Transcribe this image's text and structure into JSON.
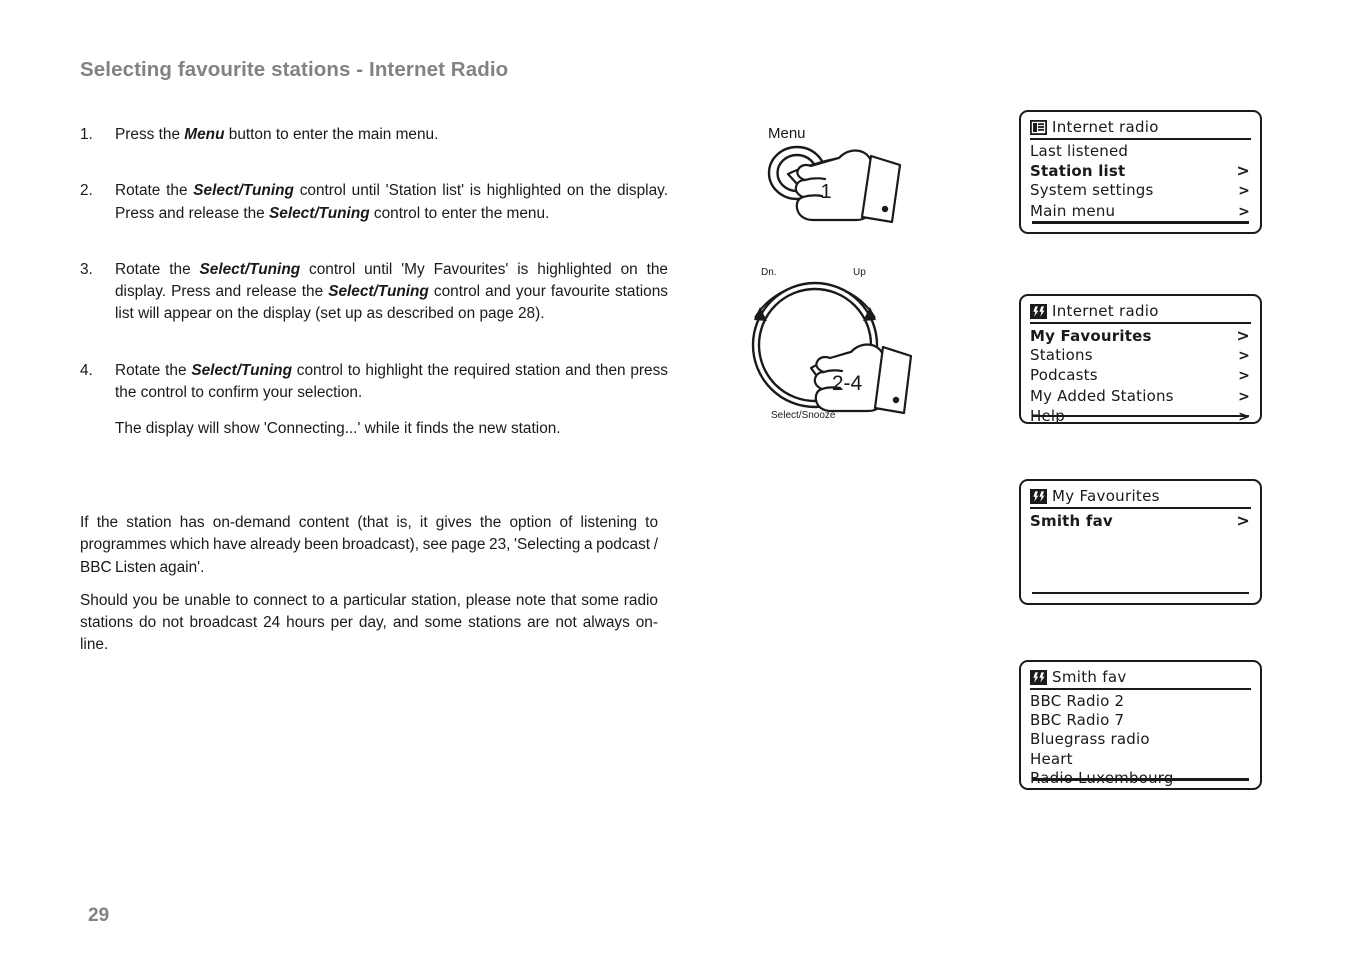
{
  "page": {
    "title": "Selecting favourite stations - Internet Radio",
    "number": "29"
  },
  "instructions": [
    {
      "num": "1.",
      "parts": [
        {
          "t": "Press the ",
          "b": false
        },
        {
          "t": "Menu",
          "b": true
        },
        {
          "t": " button to enter the main menu.",
          "b": false
        }
      ]
    },
    {
      "num": "2.",
      "parts": [
        {
          "t": "Rotate the ",
          "b": false
        },
        {
          "t": "Select/Tuning",
          "b": true
        },
        {
          "t": " control until 'Station list' is highlighted on the display. Press and release the ",
          "b": false
        },
        {
          "t": "Select/Tuning",
          "b": true
        },
        {
          "t": " control to enter the menu.",
          "b": false
        }
      ]
    },
    {
      "num": "3.",
      "parts": [
        {
          "t": "Rotate the ",
          "b": false
        },
        {
          "t": "Select/Tuning",
          "b": true
        },
        {
          "t": " control until 'My Favourites' is highlighted on the display. Press and release the ",
          "b": false
        },
        {
          "t": "Select/Tuning",
          "b": true
        },
        {
          "t": " control and your favourite stations list will appear on the display (set up as described on page 28).",
          "b": false
        }
      ]
    },
    {
      "num": "4.",
      "parts": [
        {
          "t": "Rotate the ",
          "b": false
        },
        {
          "t": "Select/Tuning",
          "b": true
        },
        {
          "t": " control to highlight the required station and then press the control to confirm your selection.",
          "b": false
        }
      ],
      "sub": "The display will show 'Connecting...' while it finds the new station."
    }
  ],
  "notes": [
    "If the station has on-demand content (that is, it gives the option of listening to programmes which have already been broadcast), see page 23, 'Selecting a podcast / BBC Listen again'.",
    "Should you be unable to connect to a particular station, please note that some radio stations do not broadcast 24 hours per day, and some stations are not always on-line."
  ],
  "illustrations": {
    "menu_button": {
      "label": "Menu",
      "step_number": "1"
    },
    "rotary": {
      "label_down": "Dn.",
      "label_up": "Up",
      "label_select": "Select/Snooze",
      "step_number": "2-4"
    }
  },
  "displays": [
    {
      "icon": "list-icon",
      "title": "Internet radio",
      "rows": [
        {
          "label": "Last listened",
          "arrow": "",
          "selected": false
        },
        {
          "label": "Station list",
          "arrow": ">",
          "selected": true
        },
        {
          "label": "System settings",
          "arrow": ">",
          "selected": false
        },
        {
          "label": "Main menu",
          "arrow": ">",
          "selected": false
        }
      ]
    },
    {
      "icon": "stations-icon",
      "title": "Internet radio",
      "rows": [
        {
          "label": "My Favourites",
          "arrow": ">",
          "selected": true
        },
        {
          "label": "Stations",
          "arrow": ">",
          "selected": false
        },
        {
          "label": "Podcasts",
          "arrow": ">",
          "selected": false
        },
        {
          "label": "My Added Stations",
          "arrow": ">",
          "selected": false
        },
        {
          "label": "Help",
          "arrow": ">",
          "selected": false
        }
      ]
    },
    {
      "icon": "stations-icon",
      "title": "My Favourites",
      "rows": [
        {
          "label": "Smith fav",
          "arrow": ">",
          "selected": true
        }
      ]
    },
    {
      "icon": "stations-icon",
      "title": "Smith fav",
      "rows": [
        {
          "label": "BBC Radio 2",
          "arrow": "",
          "selected": false
        },
        {
          "label": "BBC Radio 7",
          "arrow": "",
          "selected": false
        },
        {
          "label": "Bluegrass radio",
          "arrow": "",
          "selected": false
        },
        {
          "label": "Heart",
          "arrow": "",
          "selected": false
        },
        {
          "label": "Radio Luxembourg",
          "arrow": "",
          "selected": false
        }
      ]
    }
  ],
  "colors": {
    "heading": "#808285",
    "text": "#1a1a1a",
    "lcd_border": "#1a1a1a"
  }
}
